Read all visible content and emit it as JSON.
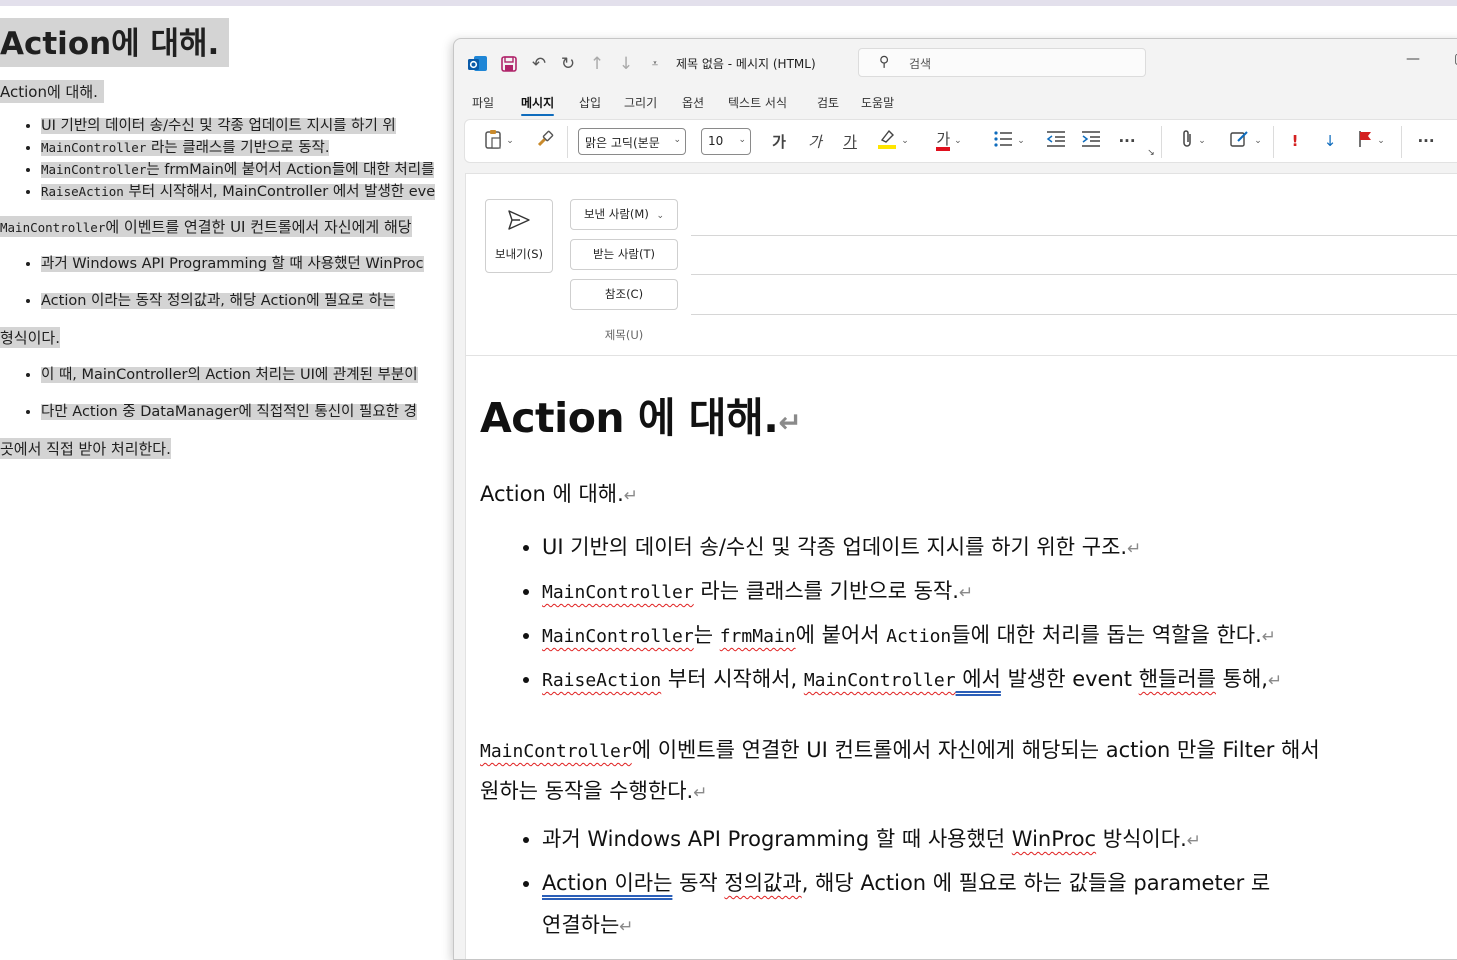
{
  "background_doc": {
    "title": "Action에 대해.",
    "subtitle": "Action에 대해.",
    "bullets_1": [
      {
        "mono": "",
        "text": "UI 기반의 데이터 송/수신 및 각종 업데이트 지시를 하기 위"
      },
      {
        "mono": "MainController",
        "text": " 라는 클래스를 기반으로 동작."
      },
      {
        "mono": "MainController",
        "text": "는 frmMain에 붙어서 Action들에 대한 처리를"
      },
      {
        "mono": "RaiseAction",
        "text": " 부터 시작해서, MainController 에서 발생한 eve"
      }
    ],
    "para_1_mono": "MainController",
    "para_1": "에 이벤트를 연결한 UI 컨트롤에서 자신에게 해당",
    "bullets_2": [
      "과거 Windows API Programming 할 때 사용했던 WinProc",
      "Action 이라는 동작 정의값과, 해당 Action에 필요로 하는"
    ],
    "para_2": "형식이다.",
    "bullets_3": [
      "이 때, MainController의 Action 처리는 UI에 관계된 부분이",
      "다만 Action 중 DataManager에 직접적인 통신이 필요한 경"
    ],
    "para_3": "곳에서 직접 받아 처리한다."
  },
  "window": {
    "title": "제목 없음  -  메시지 (HTML)",
    "search_placeholder": "검색",
    "menu": [
      "파일",
      "메시지",
      "삽입",
      "그리기",
      "옵션",
      "텍스트 서식",
      "검토",
      "도움말"
    ],
    "active_menu": "메시지",
    "font_name": "맑은 고딕(본문",
    "font_size": "10",
    "bold_glyph": "가",
    "italic_glyph": "가",
    "underline_glyph": "가",
    "fontcolor_glyph": "가",
    "more_glyph": "···"
  },
  "compose": {
    "send_label": "보내기(S)",
    "from_label": "보낸 사람(M)",
    "to_label": "받는 사람(T)",
    "cc_label": "참조(C)",
    "subject_label": "제목(U)"
  },
  "body": {
    "heading": "Action 에  대해.",
    "subheading": "Action 에  대해.",
    "bullet_1": "UI  기반의  데이터  송/수신  및  각종  업데이트  지시를  하기  위한  구조.",
    "bullet_2_mono": "MainController",
    "bullet_2": " 라는  클래스를  기반으로  동작.",
    "bullet_3_mono1": "MainController",
    "bullet_3_a": "는  ",
    "bullet_3_mono2": "frmMain",
    "bullet_3_b": "에  붙어서  ",
    "bullet_3_mono3": "Action",
    "bullet_3_c": "들에  대한  처리를  돕는  역할을  한다.",
    "bullet_4_mono1": "RaiseAction",
    "bullet_4_a": " 부터  시작해서,  ",
    "bullet_4_mono2": "MainController",
    "bullet_4_b": " 에서",
    "bullet_4_c": "  발생한  event  ",
    "bullet_4_d": "핸들러를",
    "bullet_4_e": "  통해,",
    "para_mono": "MainController",
    "para_line1": "에  이벤트를  연결한  UI  컨트롤에서  자신에게  해당되는  action 만을  Filter 해서",
    "para_line2": "원하는  동작을  수행한다.",
    "bullet_5_a": "과거  Windows  API  Programming  할  때  사용했던  ",
    "bullet_5_b": "WinProc",
    "bullet_5_c": "  방식이다.",
    "bullet_6_a": "Action  이라는",
    "bullet_6_b": "  동작  ",
    "bullet_6_c": "정의값과",
    "bullet_6_d": ",  해당  Action 에  필요로  하는  값들을  parameter 로",
    "bullet_6_line2": "연결하는",
    "para_mark": "↵"
  }
}
